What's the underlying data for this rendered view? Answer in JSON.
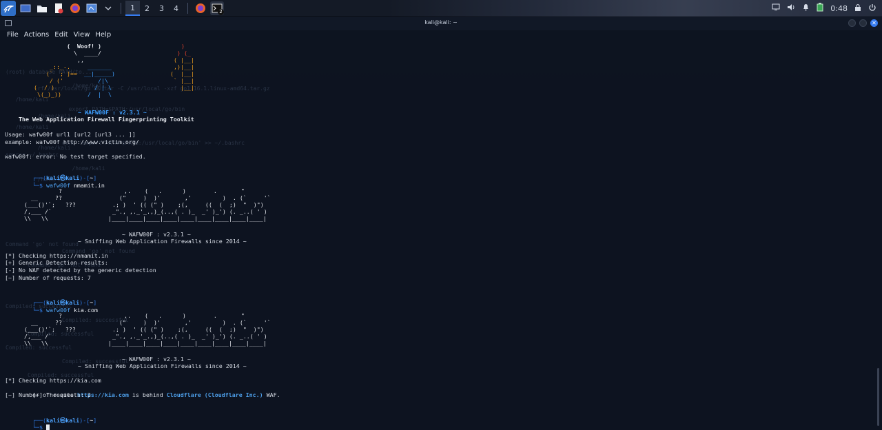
{
  "panel": {
    "workspaces": [
      "1",
      "2",
      "3",
      "4"
    ],
    "time": "0:48",
    "terminal_badge": "2"
  },
  "window": {
    "title": "kali@kali: ~",
    "menu": [
      "File",
      "Actions",
      "Edit",
      "View",
      "Help"
    ]
  },
  "terminal": {
    "woof": {
      "bubble": "(  Woof! )",
      "dog": [
        "  \\  ____/",
        "   ,,",
        " _::_-.",
        "(`  ; ]==",
        " / ('",
        "(  / )",
        " \\(_)_))"
      ],
      "gun": [
        "  _______",
        " __|_____)",
        "   /|\\",
        "  / | \\",
        " /  |  \\"
      ],
      "fire": [
        ")",
        ") (_",
        "( |__|",
        ",)|__|",
        "(  |__|",
        " ` |__|",
        "   |__|"
      ]
    },
    "banner1_version": "~ WAFW00F : v2.3.1 ~",
    "tagline": "The Web Application Firewall Fingerprinting Toolkit",
    "usage": "Usage: wafw00f url1 [url2 [url3 ... ]]",
    "example": "example: wafw00f http://www.victim.org/",
    "error": "wafw00f: error: No test target specified.",
    "prompt_user": "kali",
    "prompt_at": "㉿",
    "prompt_host": "kali",
    "prompt_dir": "~",
    "prompt_open": "┌──(",
    "prompt_close": ")-[",
    "prompt_end": "]",
    "prompt_dollar": "└─$",
    "run1_cmd": "wafw00f",
    "run1_arg": "nmamit.in",
    "art": {
      "left": [
        "            ?",
        "    __     ??",
        "  (___()'`;   ???",
        "  /,___ /`",
        "  \\\\   \\\\"
      ],
      "right": [
        " ,.    (   .      )        .       \"",
        "(\"     )  )'       ,'         )  . (`     '`",
        ".; )  ' (( (\" )    ;(,     ((  (  ;)  \"  )\")",
        "_\"., ,._'_.,)_(..,( . )_  _' )_') (. _..( ' )",
        "|____|____|____|____|____|____|____|____|____|"
      ]
    },
    "version": "~ WAFW00F : v2.3.1 ~",
    "subtitle": "~ Sniffing Web Application Firewalls since 2014 ~",
    "run1_output": [
      "[*] Checking https://nmamit.in",
      "[+] Generic Detection results:",
      "[-] No WAF detected by the generic detection",
      "[~] Number of requests: 7"
    ],
    "run2_cmd": "wafw00f",
    "run2_arg": "kia.com",
    "run2_checking": "[*] Checking https://kia.com",
    "run2_site_pre": "[+] The site ",
    "run2_site_url": "https://kia.com",
    "run2_site_mid": " is behind ",
    "run2_site_waf": "Cloudflare (Cloudflare Inc.)",
    "run2_site_post": " WAF.",
    "run2_requests": "[~] Number of requests: 2"
  },
  "background_text": [
    "(root) database PATH/to...",
    "   /home/kali",
    "  -rf /usr/local/go && tar -C /usr/local -xzf go1.16.1.linux-amd64.tar.gz",
    "   /home/kali",
    "  export PATH=$PATH:/usr/local/go/bin",
    "   /home/kali",
    "   /home/kali",
    "echo 'export PATH=$PATH:/usr/local/go/bin' >> ~/.bashrc",
    "   /home/kali",
    "source ~/.bashrc",
    "   /home/kali",
    "   /home/kali",
    "Command 'go' not found",
    "Command 'go' not found",
    "Command 'go' not found",
    "Compiled: successful",
    "Compiled: successful",
    "Compiled: successful",
    "Compiled: successful",
    "Compiled: successful",
    "Compiled: successful"
  ]
}
